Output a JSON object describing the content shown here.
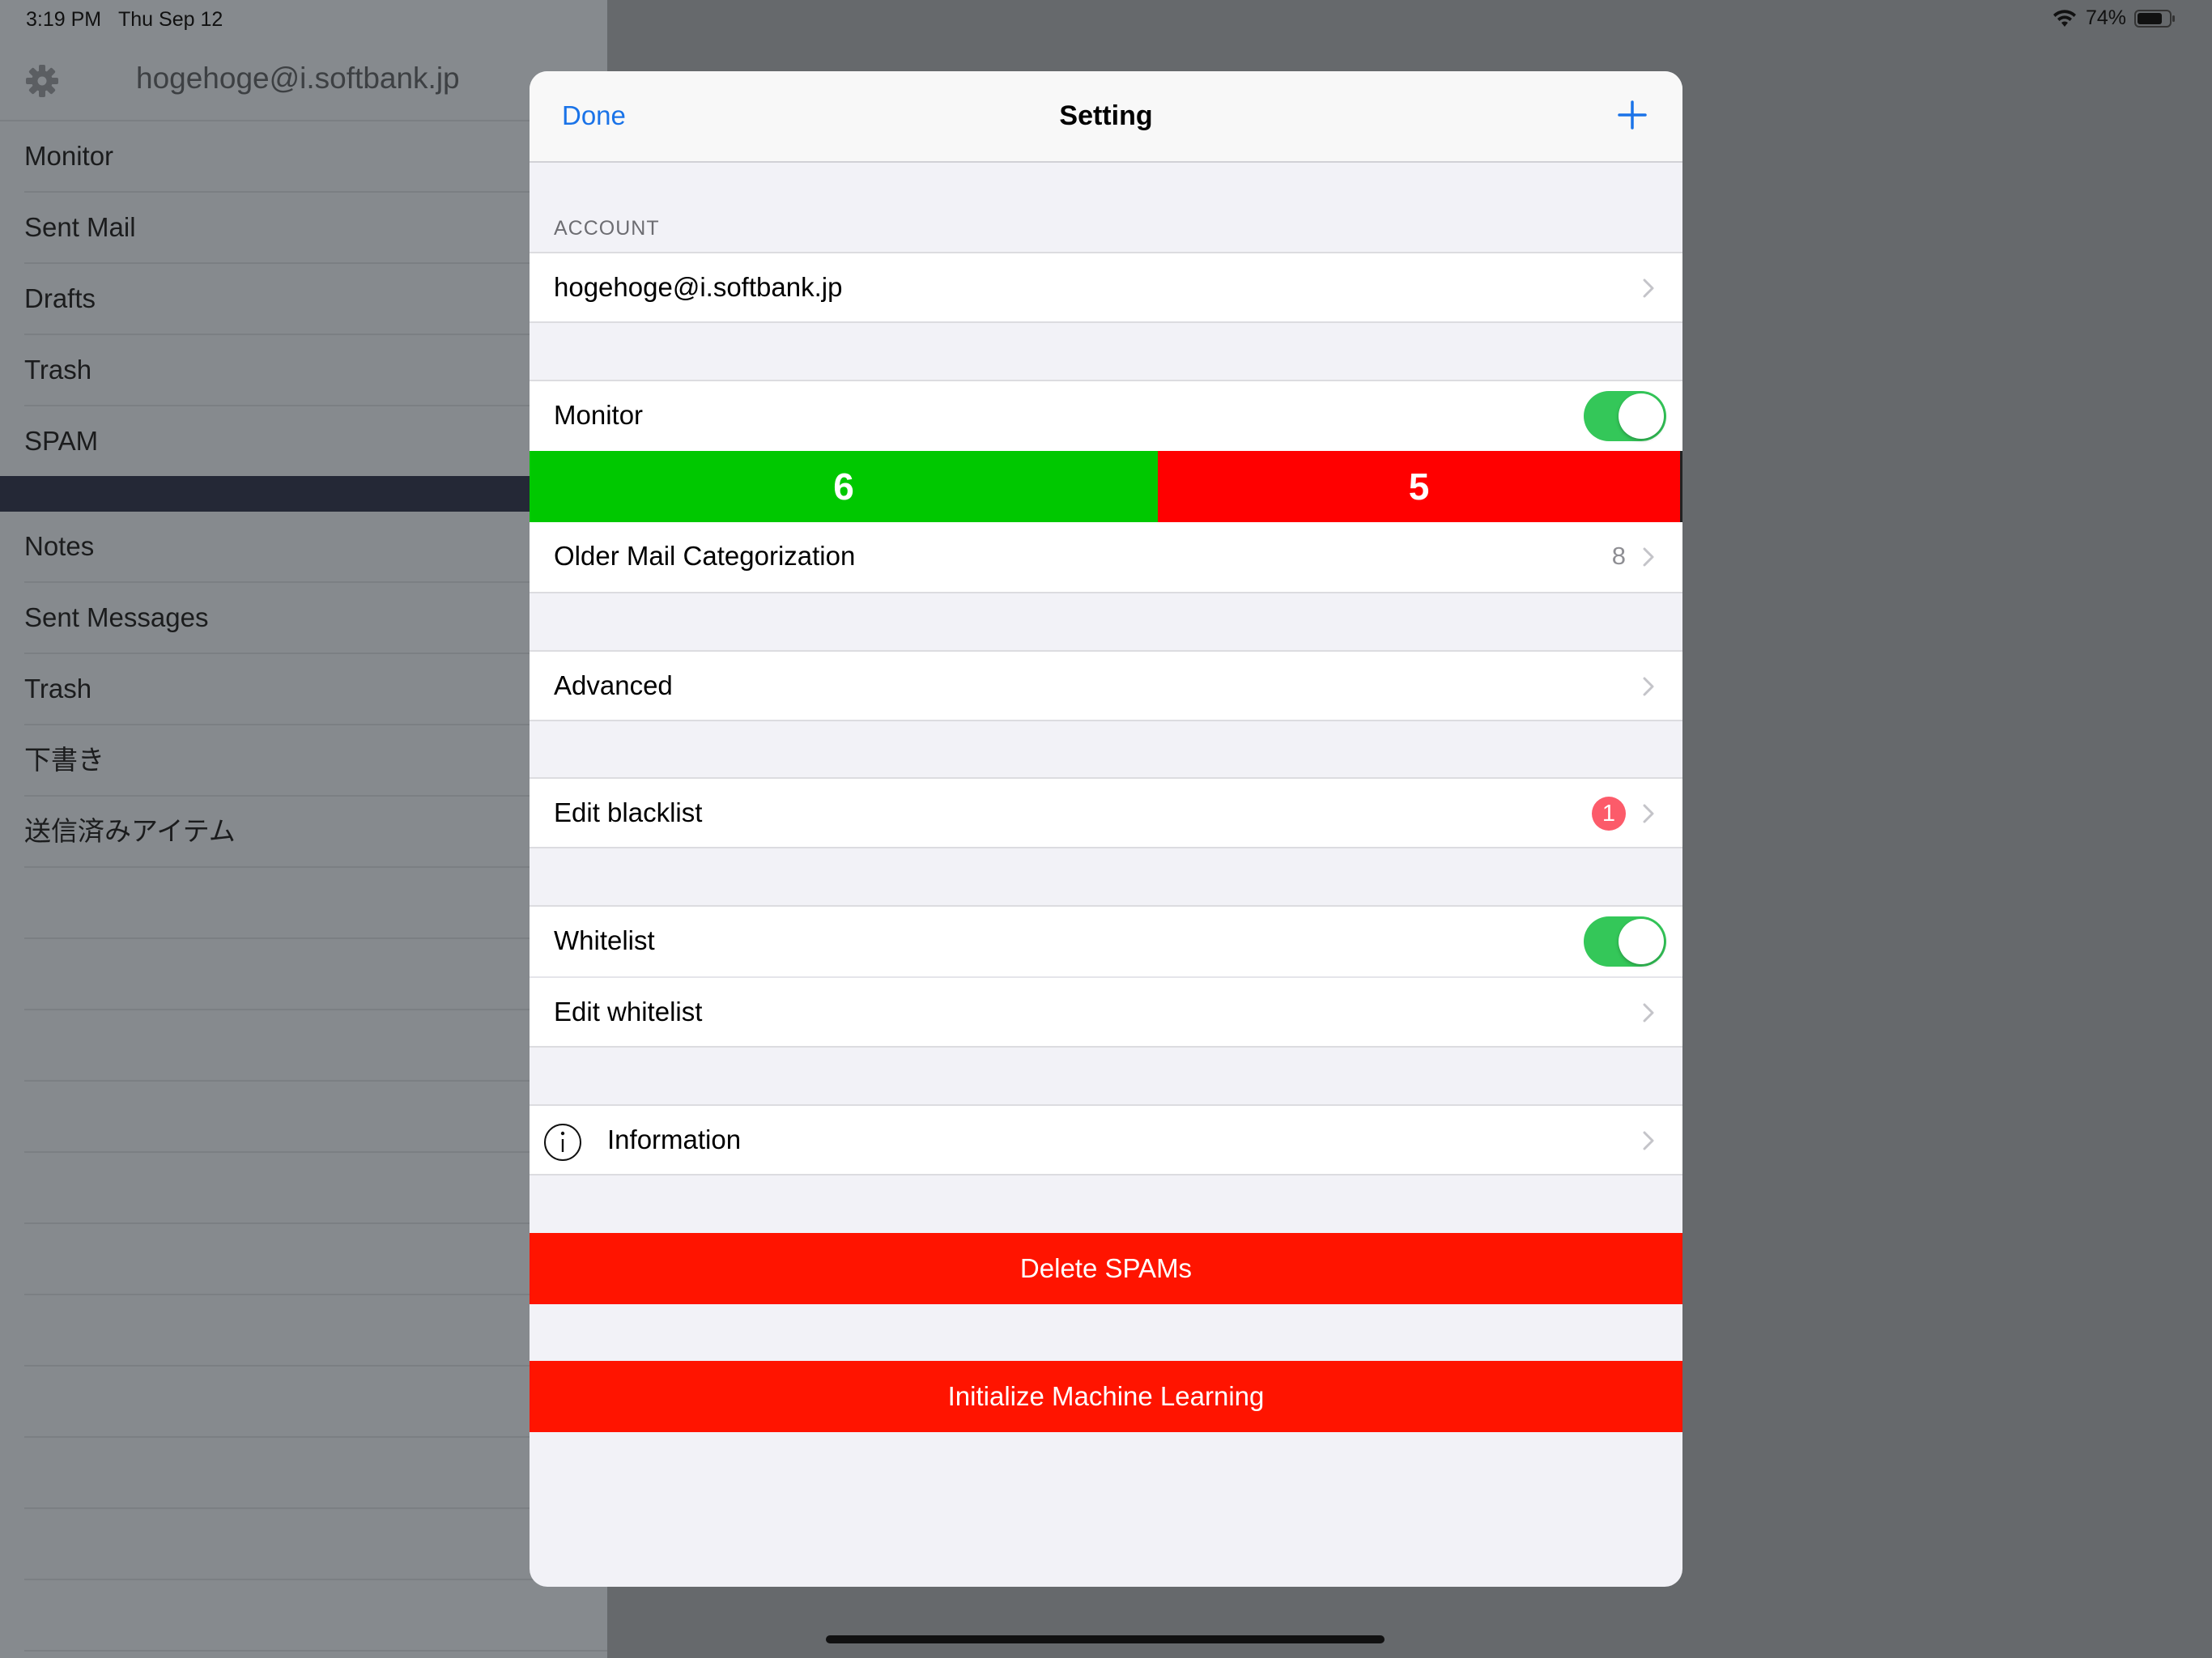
{
  "status_bar": {
    "time": "3:19 PM",
    "date": "Thu Sep 12",
    "battery_percent": "74%",
    "icons": [
      "wifi-icon",
      "battery-icon"
    ]
  },
  "sidebar": {
    "account": "hogehoge@i.softbank.jp",
    "mailboxes": [
      "Monitor",
      "Sent Mail",
      "Drafts",
      "Trash",
      "SPAM"
    ],
    "other_folders": [
      "Notes",
      "Sent Messages",
      "Trash",
      "下書き",
      "送信済みアイテム"
    ],
    "icons": [
      "gear-icon"
    ]
  },
  "modal": {
    "nav": {
      "done_label": "Done",
      "title": "Setting",
      "add_icon": "plus-icon"
    },
    "account_section": {
      "header": "ACCOUNT",
      "account": "hogehoge@i.softbank.jp"
    },
    "monitor": {
      "label": "Monitor",
      "enabled": true,
      "good_count": "6",
      "spam_count": "5",
      "colors": {
        "good": "#00c800",
        "spam": "#ff0000"
      }
    },
    "older_mail": {
      "label": "Older Mail Categorization",
      "value": "8"
    },
    "advanced": {
      "label": "Advanced"
    },
    "blacklist": {
      "label": "Edit blacklist",
      "badge": "1",
      "badge_color": "#fc5b6a"
    },
    "whitelist": {
      "label": "Whitelist",
      "enabled": true,
      "edit_label": "Edit whitelist"
    },
    "information": {
      "label": "Information",
      "icon": "info-icon"
    },
    "actions": {
      "delete_spams": "Delete SPAMs",
      "initialize_ml": "Initialize Machine Learning",
      "color": "#ff1400"
    },
    "colors": {
      "accent": "#1a73e8",
      "toggle_on": "#34c759"
    }
  }
}
